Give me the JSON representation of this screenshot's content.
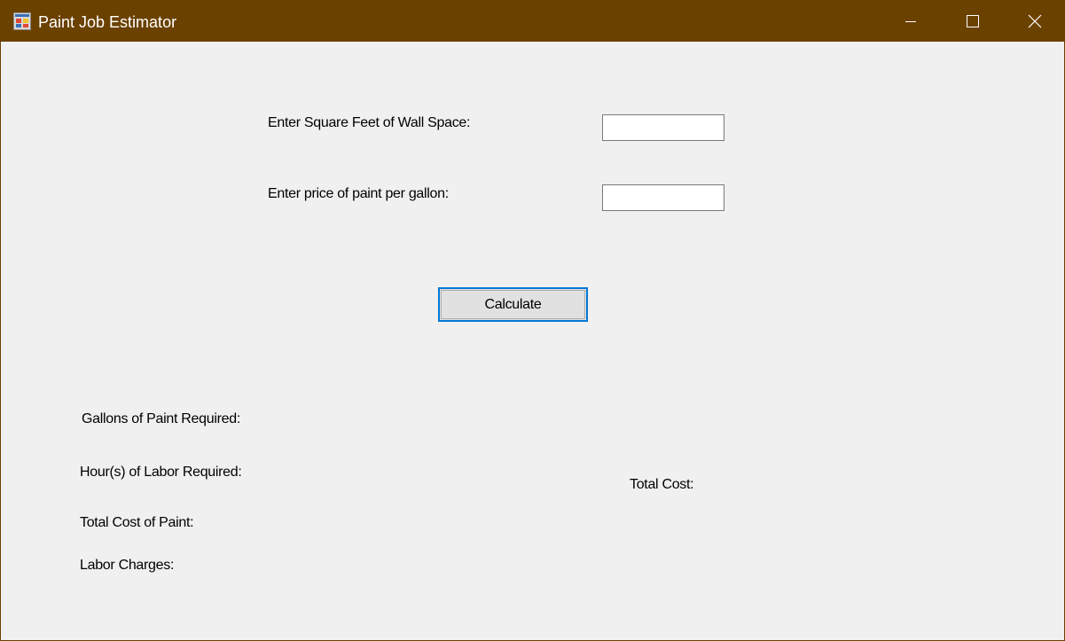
{
  "window": {
    "title": "Paint Job Estimator",
    "icon": "winforms-app-icon",
    "titlebar_color": "#6b4100",
    "controls": {
      "minimize": "minimize-icon",
      "maximize": "maximize-icon",
      "close": "close-icon"
    }
  },
  "inputs": {
    "sqft": {
      "label": "Enter Square Feet of Wall Space:",
      "value": ""
    },
    "price": {
      "label": "Enter price of paint per gallon:",
      "value": ""
    }
  },
  "actions": {
    "calculate_label": "Calculate",
    "focus_color": "#0078d7"
  },
  "results": {
    "gallons_label": "Gallons of Paint Required:",
    "hours_label": "Hour(s) of Labor Required:",
    "paint_cost_label": "Total Cost of Paint:",
    "labor_charges_label": "Labor Charges:",
    "total_cost_label": "Total Cost:"
  }
}
